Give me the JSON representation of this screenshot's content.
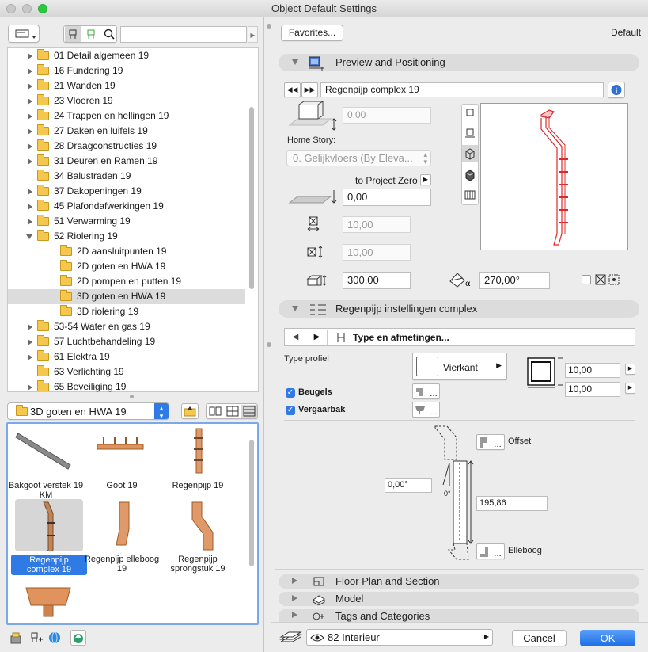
{
  "window": {
    "title": "Object Default Settings"
  },
  "left": {
    "tree": [
      {
        "label": "01 Detail algemeen 19",
        "level": 0,
        "exp": "r"
      },
      {
        "label": "16 Fundering 19",
        "level": 0,
        "exp": "r"
      },
      {
        "label": "21 Wanden 19",
        "level": 0,
        "exp": "r"
      },
      {
        "label": "23 Vloeren 19",
        "level": 0,
        "exp": "r"
      },
      {
        "label": "24 Trappen en hellingen 19",
        "level": 0,
        "exp": "r"
      },
      {
        "label": "27 Daken en luifels 19",
        "level": 0,
        "exp": "r"
      },
      {
        "label": "28 Draagconstructies 19",
        "level": 0,
        "exp": "r"
      },
      {
        "label": "31 Deuren en Ramen 19",
        "level": 0,
        "exp": "r"
      },
      {
        "label": "34 Balustraden 19",
        "level": 0,
        "exp": ""
      },
      {
        "label": "37 Dakopeningen 19",
        "level": 0,
        "exp": "r"
      },
      {
        "label": "45 Plafondafwerkingen 19",
        "level": 0,
        "exp": "r"
      },
      {
        "label": "51 Verwarming 19",
        "level": 0,
        "exp": "r"
      },
      {
        "label": "52 Riolering 19",
        "level": 0,
        "exp": "d"
      },
      {
        "label": "2D aansluitpunten 19",
        "level": 1,
        "exp": ""
      },
      {
        "label": "2D goten en HWA 19",
        "level": 1,
        "exp": ""
      },
      {
        "label": "2D pompen en putten 19",
        "level": 1,
        "exp": ""
      },
      {
        "label": "3D goten en HWA 19",
        "level": 1,
        "exp": "",
        "selected": true
      },
      {
        "label": "3D riolering 19",
        "level": 1,
        "exp": ""
      },
      {
        "label": "53-54 Water en gas 19",
        "level": 0,
        "exp": "r"
      },
      {
        "label": "57 Luchtbehandeling 19",
        "level": 0,
        "exp": "r"
      },
      {
        "label": "61 Elektra 19",
        "level": 0,
        "exp": "r"
      },
      {
        "label": "63 Verlichting 19",
        "level": 0,
        "exp": ""
      },
      {
        "label": "65 Beveiliging 19",
        "level": 0,
        "exp": "r"
      }
    ],
    "folder_select": "3D goten en HWA 19",
    "items": [
      {
        "label": "Bakgoot verstek 19 KM",
        "shape": "bakgoot"
      },
      {
        "label": "Goot 19",
        "shape": "goot"
      },
      {
        "label": "Regenpijp 19",
        "shape": "regenpijp"
      },
      {
        "label": "Regenpijp complex 19",
        "shape": "complex",
        "selected": true
      },
      {
        "label": "Regenpijp elleboog 19",
        "shape": "elleboog"
      },
      {
        "label": "Regenpijp sprongstuk 19",
        "shape": "sprongstuk"
      },
      {
        "label": "",
        "shape": "vergaarbak"
      }
    ]
  },
  "right": {
    "favorites": "Favorites...",
    "default_label": "Default",
    "sec_preview": "Preview and Positioning",
    "object_name": "Regenpijp complex 19",
    "elev_value": "0,00",
    "home_story_label": "Home Story:",
    "home_story_value": "0. Gelijkvloers (By Eleva...",
    "to_project_zero": "to Project Zero",
    "zero_value": "0,00",
    "width_value": "10,00",
    "depth_value": "10,00",
    "height_value": "300,00",
    "angle_value": "270,00°",
    "sec_settings": "Regenpijp instellingen complex",
    "type_label": "Type en afmetingen...",
    "type_profiel": "Type profiel",
    "vierkant": "Vierkant",
    "dim1": "10,00",
    "dim2": "10,00",
    "beugels": "Beugels",
    "vergaarbak": "Vergaarbak",
    "offset": "Offset",
    "angle_small": "0,00°",
    "zero_deg": "0°",
    "length": "195,86",
    "elleboog": "Elleboog",
    "sec_floor": "Floor Plan and Section",
    "sec_model": "Model",
    "sec_tags": "Tags and Categories",
    "layer": "82 Interieur",
    "cancel": "Cancel",
    "ok": "OK"
  },
  "colors": {
    "accent": "#2f7ae5",
    "pipe_red": "#e0282a",
    "copper": "#d88a55"
  }
}
